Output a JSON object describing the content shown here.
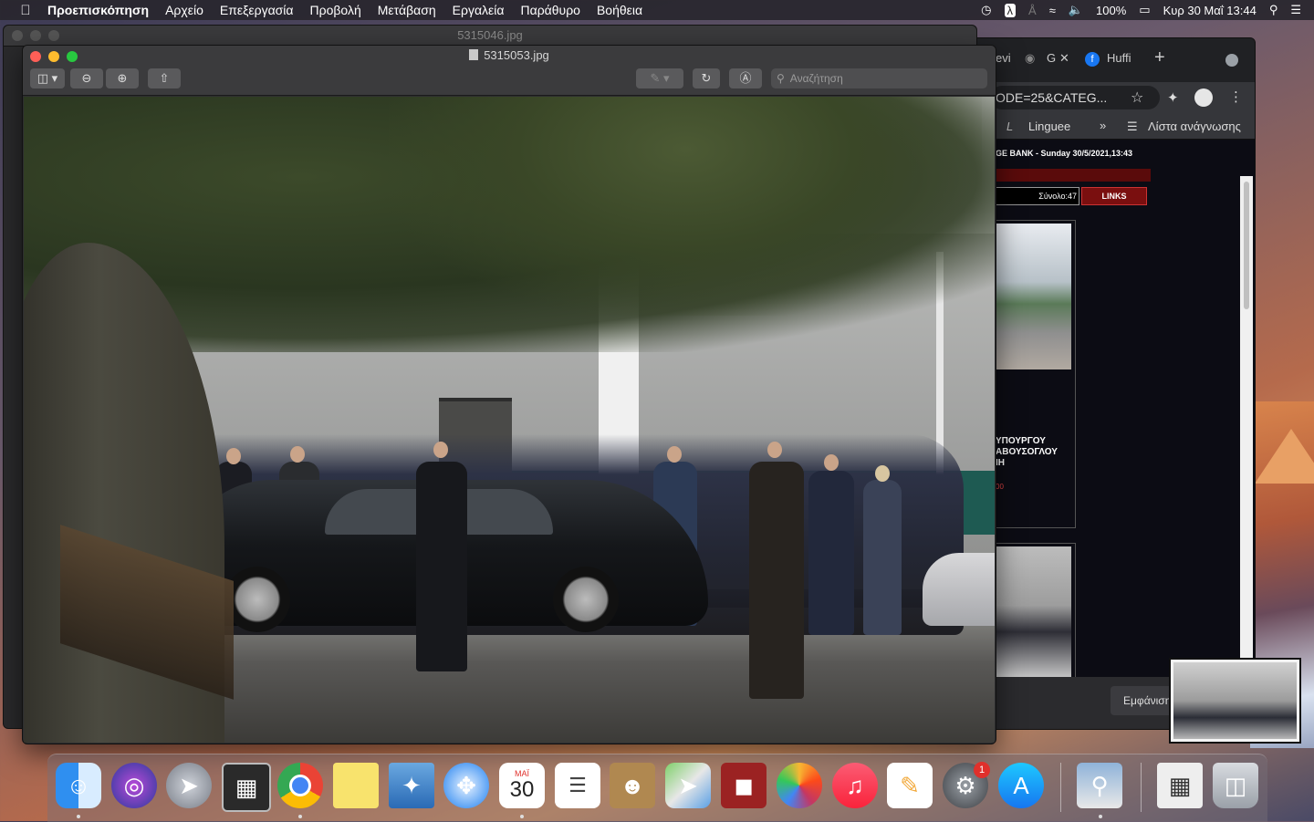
{
  "menubar": {
    "app_name": "Προεπισκόπηση",
    "items": [
      "Αρχείο",
      "Επεξεργασία",
      "Προβολή",
      "Μετάβαση",
      "Εργαλεία",
      "Παράθυρο",
      "Βοήθεια"
    ],
    "battery": "100%",
    "clock": "Κυρ 30 Μαΐ  13:44"
  },
  "background_window": {
    "title": "5315046.jpg"
  },
  "front_window": {
    "title": "5315053.jpg",
    "search_placeholder": "Αναζήτηση"
  },
  "chrome": {
    "tab_partial_1": "evi",
    "tab_partial_2": "G",
    "tab_partial_3": "Huffi",
    "address": "ODE=25&CATEG...",
    "bookmark_linguee": "Linguee",
    "bookmark_more": "»",
    "reading_list": "Λίστα ανάγνωσης",
    "page_header": "GE BANK  -  Sunday 30/5/2021,13:43",
    "total_count": "Σύνολο:47",
    "links_button": "LINKS",
    "card_text_1": "ΥΠΟΥΡΓΟΥ",
    "card_text_2": "ΑΒΟΥΣΟΓΛΟΥ",
    "card_text_3": "ΙΗ",
    "card_number": "00",
    "show_button": "Εμφάνιση"
  },
  "dock": {
    "calendar_month": "ΜΑΪ",
    "calendar_day": "30",
    "system_prefs_badge": "1"
  },
  "colors": {
    "menubar_bg": "#28262e",
    "window_bg": "#2d2d2f",
    "close": "#ff5f57",
    "minimize": "#febc2e",
    "zoom": "#28c840",
    "links_red": "#7a0f0f"
  }
}
